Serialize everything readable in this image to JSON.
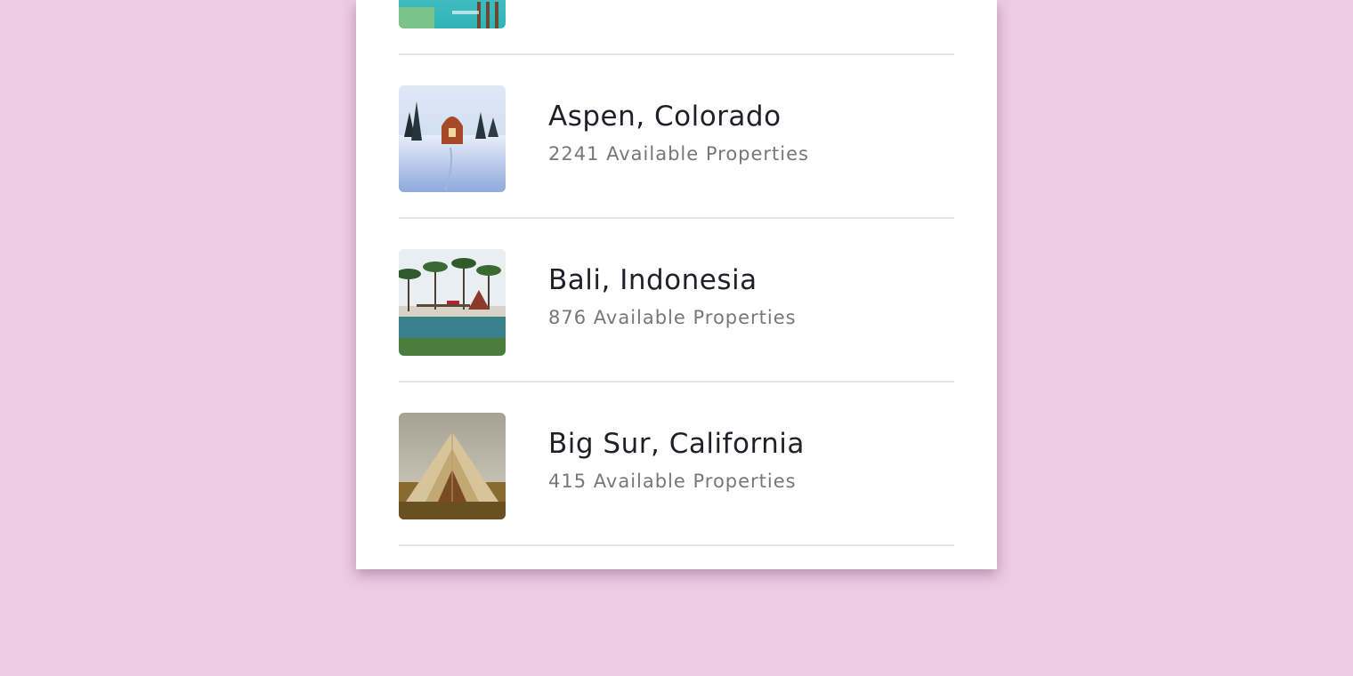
{
  "destinations": [
    {
      "name": "",
      "count": "",
      "thumbnail_icon": "lagoon-overwater-image"
    },
    {
      "name": "Aspen, Colorado",
      "count": "2241 Available Properties",
      "thumbnail_icon": "snow-cabin-image"
    },
    {
      "name": "Bali, Indonesia",
      "count": "876 Available Properties",
      "thumbnail_icon": "beach-pool-resort-image"
    },
    {
      "name": "Big Sur, California",
      "count": "415 Available Properties",
      "thumbnail_icon": "glamping-tent-image"
    }
  ],
  "colors": {
    "page_background": "#edcbe3",
    "card_background": "#ffffff",
    "title_text": "#1f2128",
    "subtitle_text": "#777777",
    "divider": "#e6e6e6"
  }
}
